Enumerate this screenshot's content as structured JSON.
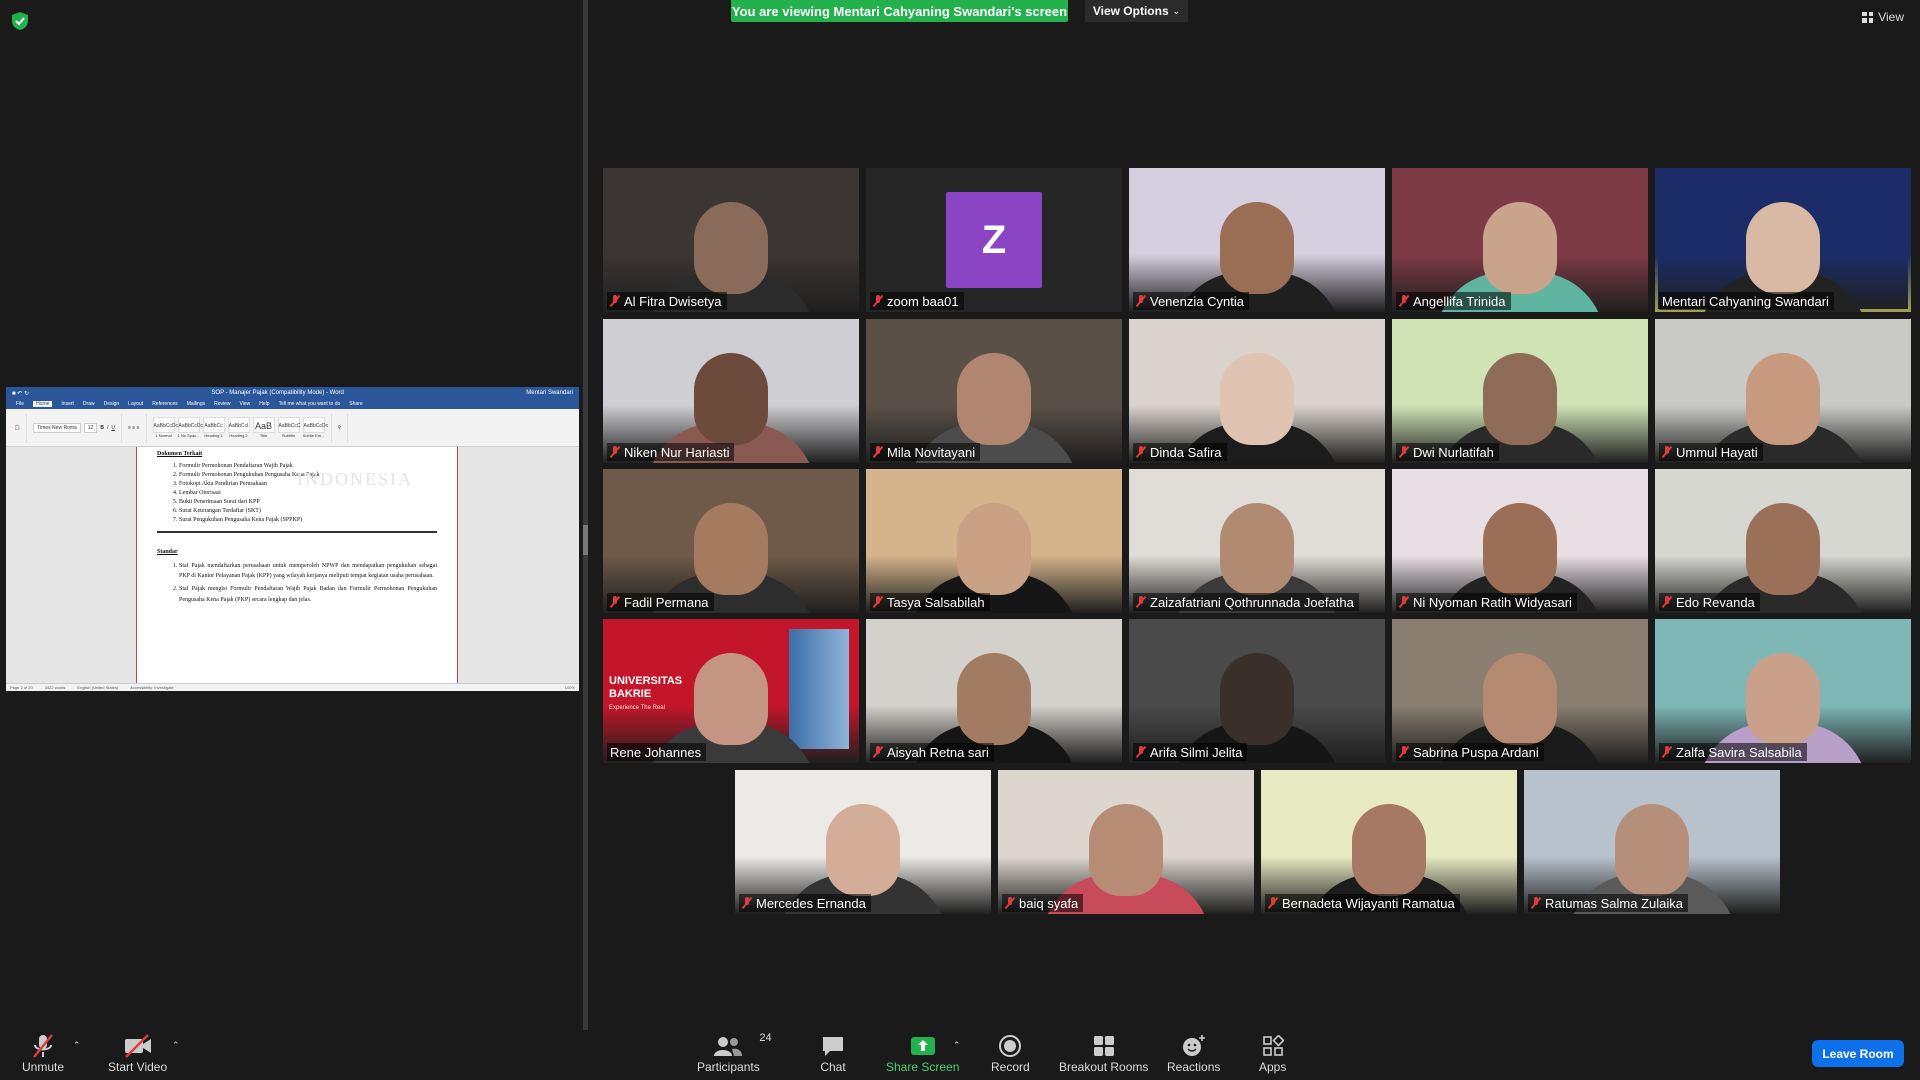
{
  "banner": {
    "text": "You are viewing Mentari Cahyaning Swandari's screen",
    "color": "#23b14d"
  },
  "view_options": {
    "label": "View Options",
    "icon": "chevron-down-icon"
  },
  "view": {
    "label": "View",
    "icon": "grid-icon"
  },
  "shared_doc": {
    "title": "SOP - Manajer Pajak (Compatibility Mode) - Word",
    "user": "Mentari Swandari",
    "tabs": [
      "File",
      "Home",
      "Insert",
      "Draw",
      "Design",
      "Layout",
      "References",
      "Mailings",
      "Review",
      "View",
      "Help",
      "Tell me what you want to do",
      "Share"
    ],
    "active_tab": "Home",
    "font_name": "Times New Roma",
    "font_size": "12",
    "styles": [
      "AaBbCcDc",
      "AaBbCcDc",
      "AaBbCc",
      "AaBbCcI",
      "AaB",
      "AaBbCcC",
      "AaBbCcDc"
    ],
    "style_names": [
      "1 Normal",
      "1 No Spac...",
      "Heading 1",
      "Heading 2",
      "Title",
      "Subtitle",
      "Subtle Em..."
    ],
    "heading_terkait": "Dokumen Terkait",
    "related_docs": [
      "Formulir Permohonan Pendaftaran Wajib Pajak",
      "Formulir Permohonan Pengukuhan Pengusaha Kena Pajak",
      "Fotokopi Akta Pendirian Perusahaan",
      "Lembar Otorisasi",
      "Bukti Penerimaan Surat dari KPP",
      "Surat Keterangan Terdaftar (SKT)",
      "Surat Pengukuhan Pengusaha Kena Pajak (SPPKP)"
    ],
    "heading_standar": "Standar",
    "standards": [
      "Staf Pajak mendaftarkan perusahaan untuk memperoleh NPWP dan mendapatkan pengukuhan sebagai PKP di Kantor Pelayanan Pajak (KPP) yang wilayah kerjanya meliputi tempat kegiatan usaha perusahaan.",
      "Staf Pajak mengisi Formulir Pendaftaran Wajib Pajak Badan dan Formulir Permohonan Pengukuhan Pengusaha Kena Pajak (PKP) secara lengkap dan jelas."
    ],
    "watermark": "INDONESIA",
    "status_page": "Page 2 of 20",
    "status_words": "3422 words",
    "status_lang": "English (United States)",
    "status_access": "Accessibility: Investigate",
    "status_zoom": "100%"
  },
  "participants": [
    {
      "name": "Al Fitra Dwisetya",
      "muted": true,
      "bg": "#3b3533",
      "skin": "#8a6a58",
      "shirt": "#2b2b2b"
    },
    {
      "name": "zoom baa01",
      "muted": true,
      "avatar": "Z",
      "avatar_color": "#8a44c4"
    },
    {
      "name": "Venenzia Cyntia",
      "muted": true,
      "bg": "#d6cfe0",
      "skin": "#9a6d55",
      "shirt": "#1f1f1f"
    },
    {
      "name": "Angellifa Trinida",
      "muted": true,
      "bg": "#7d3b45",
      "skin": "#caa38c",
      "shirt": "#5fb5a0"
    },
    {
      "name": "Mentari Cahyaning Swandari",
      "muted": false,
      "active": true,
      "bg": "#1c2c68",
      "skin": "#d9b9a3",
      "shirt": "#222"
    },
    {
      "name": "Niken Nur Hariasti",
      "muted": true,
      "bg": "#cfcfd3",
      "skin": "#6d4b3c",
      "shirt": "#8a5a52"
    },
    {
      "name": "Mila Novitayani",
      "muted": true,
      "bg": "#5a5048",
      "skin": "#b08670",
      "shirt": "#4c4c4c"
    },
    {
      "name": "Dinda Safira",
      "muted": true,
      "bg": "#d9d3cc",
      "skin": "#e0c3b0",
      "shirt": "#1c1c1c"
    },
    {
      "name": "Dwi Nurlatifah",
      "muted": true,
      "bg": "#cfe3b5",
      "skin": "#8e6c57",
      "shirt": "#2a2a2a"
    },
    {
      "name": "Ummul Hayati",
      "muted": true,
      "bg": "#c9c9c6",
      "skin": "#c79a80",
      "shirt": "#2a2a2a"
    },
    {
      "name": "Fadil Permana",
      "muted": true,
      "bg": "#6e5a48",
      "skin": "#a57b60",
      "shirt": "#2d2d2d"
    },
    {
      "name": "Tasya Salsabilah",
      "muted": true,
      "bg": "#d5b48c",
      "skin": "#c9a286",
      "shirt": "#161616"
    },
    {
      "name": "Zaizafatriani Qothrunnada Joefatha",
      "muted": true,
      "bg": "#e0dcd7",
      "skin": "#b08b72",
      "shirt": "#3a3a3a"
    },
    {
      "name": "Ni Nyoman Ratih Widyasari",
      "muted": true,
      "bg": "#e8dfe4",
      "skin": "#9b6e58",
      "shirt": "#222"
    },
    {
      "name": "Edo Revanda",
      "muted": true,
      "bg": "#d7d7d2",
      "skin": "#9a7158",
      "shirt": "#2a2a2a"
    },
    {
      "name": "Rene Johannes",
      "muted": false,
      "bg": "#c3162a",
      "skin": "#c49582",
      "shirt": "#3a3a3a",
      "banner_text": "UNIVERSITAS BAKRIE",
      "banner_sub": "Experience The Real"
    },
    {
      "name": "Aisyah Retna sari",
      "muted": true,
      "bg": "#d4d0cb",
      "skin": "#a27b63",
      "shirt": "#151515"
    },
    {
      "name": "Arifa Silmi Jelita",
      "muted": true,
      "bg": "#4a4a4a",
      "skin": "#3b2f2a",
      "shirt": "#161616"
    },
    {
      "name": "Sabrina Puspa Ardani",
      "muted": true,
      "bg": "#8a7e70",
      "skin": "#b58a72",
      "shirt": "#1b1b1b"
    },
    {
      "name": "Zalfa Savira Salsabila",
      "muted": true,
      "bg": "#7fb7b7",
      "skin": "#c9a08a",
      "shirt": "#b8a0c8"
    },
    {
      "name": "Mercedes Ernanda",
      "muted": true,
      "bg": "#ece9e6",
      "skin": "#d3ad98",
      "shirt": "#333"
    },
    {
      "name": "baiq syafa",
      "muted": true,
      "bg": "#ddd6cf",
      "skin": "#b78c75",
      "shirt": "#c84b5b"
    },
    {
      "name": "Bernadeta Wijayanti Ramatua",
      "muted": true,
      "bg": "#e8eac2",
      "skin": "#a57963",
      "shirt": "#1c1c1c"
    },
    {
      "name": "Ratumas Salma Zulaika",
      "muted": true,
      "bg": "#b7c2cc",
      "skin": "#b58f7a",
      "shirt": "#5a5a5a"
    }
  ],
  "toolbar": {
    "unmute": "Unmute",
    "start_video": "Start Video",
    "participants": "Participants",
    "participants_count": "24",
    "chat": "Chat",
    "share_screen": "Share Screen",
    "record": "Record",
    "breakout_rooms": "Breakout Rooms",
    "reactions": "Reactions",
    "apps": "Apps",
    "leave_room": "Leave Room"
  }
}
